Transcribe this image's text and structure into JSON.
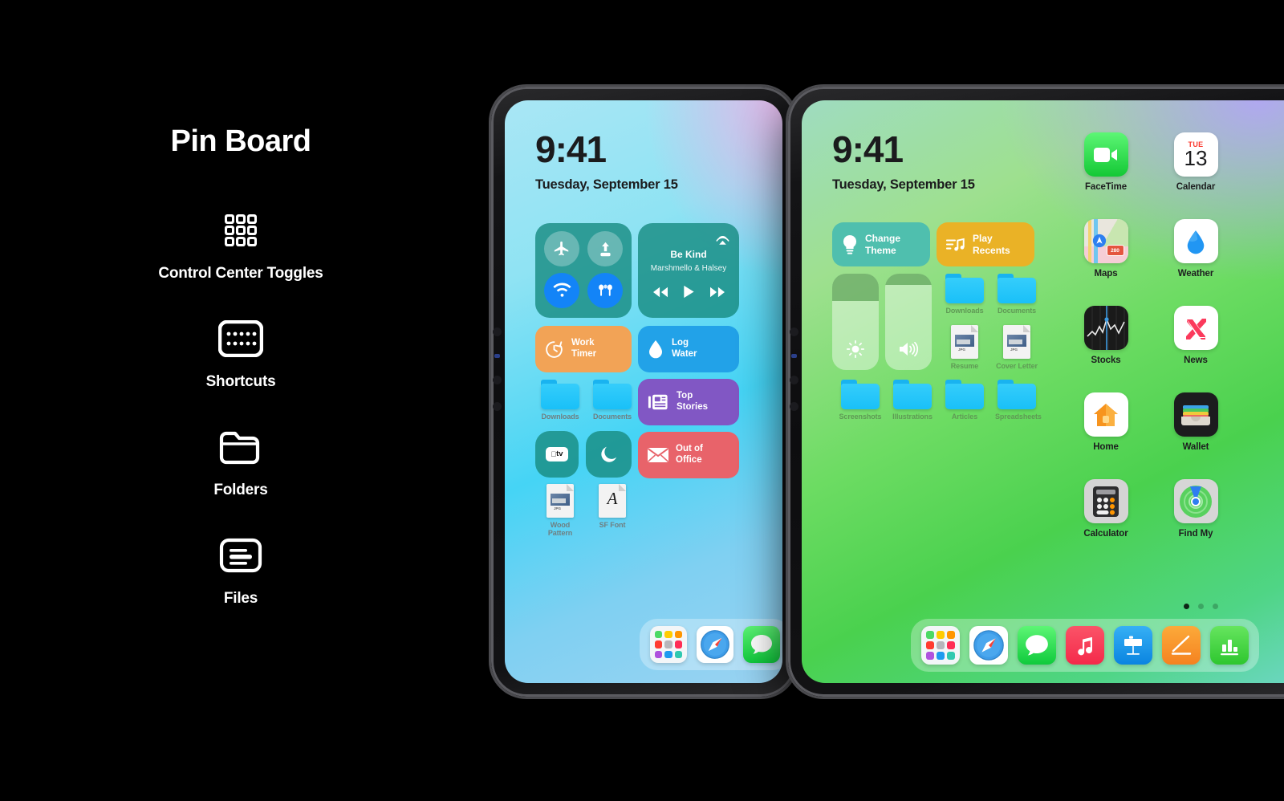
{
  "left_panel": {
    "title": "Pin Board",
    "features": [
      {
        "icon": "control-center-grid-icon",
        "label": "Control Center Toggles"
      },
      {
        "icon": "shortcuts-keyboard-icon",
        "label": "Shortcuts"
      },
      {
        "icon": "folder-icon",
        "label": "Folders"
      },
      {
        "icon": "files-card-icon",
        "label": "Files"
      }
    ]
  },
  "ipad_left": {
    "device": "iPad",
    "status": {
      "time": "9:41",
      "date": "Tuesday, September 15"
    },
    "toggles_tile": {
      "name": "control-center-toggles",
      "buttons": [
        {
          "icon": "airplane-icon",
          "state": "off"
        },
        {
          "icon": "airdrop-icon",
          "state": "off"
        },
        {
          "icon": "wifi-icon",
          "state": "on"
        },
        {
          "icon": "airpods-icon",
          "state": "on"
        }
      ]
    },
    "now_playing": {
      "track": "Be Kind",
      "artist": "Marshmello & Halsey",
      "airplay_icon": "airplay-icon",
      "controls": [
        "rewind-icon",
        "play-icon",
        "fast-forward-icon"
      ]
    },
    "shortcuts": [
      {
        "label": "Work\nTimer",
        "label_l1": "Work",
        "label_l2": "Timer",
        "icon": "timer-icon",
        "color": "#f2a356"
      },
      {
        "label": "Log Water",
        "label_l1": "Log",
        "label_l2": "Water",
        "icon": "droplet-icon",
        "color": "#22a2e8"
      },
      {
        "label": "Top Stories",
        "label_l1": "Top",
        "label_l2": "Stories",
        "icon": "news-icon",
        "color": "#8157c4"
      },
      {
        "label": "Out of Office",
        "label_l1": "Out of",
        "label_l2": "Office",
        "icon": "envelope-icon",
        "color": "#e8636a"
      }
    ],
    "folders": [
      {
        "label": "Downloads",
        "icon": "folder-icon"
      },
      {
        "label": "Documents",
        "icon": "folder-icon"
      }
    ],
    "app_tiles": [
      {
        "label": "Apple TV",
        "icon": "appletv-icon"
      },
      {
        "label": "Do Not Disturb",
        "icon": "moon-icon"
      }
    ],
    "files": [
      {
        "label": "Wood Pattern",
        "icon": "jpg-file-icon",
        "kind": "JPG"
      },
      {
        "label": "SF Font",
        "icon": "font-file-icon",
        "kind": "A"
      }
    ],
    "dock": [
      {
        "label": "App Library",
        "icon": "app-library-icon"
      },
      {
        "label": "Safari",
        "icon": "safari-icon"
      },
      {
        "label": "Messages",
        "icon": "messages-icon"
      }
    ]
  },
  "ipad_right": {
    "device": "iPad",
    "status": {
      "time": "9:41",
      "date": "Tuesday, September 15"
    },
    "shortcuts": [
      {
        "label_l1": "Change",
        "label_l2": "Theme",
        "icon": "lightbulb-icon",
        "color": "#4fbfae"
      },
      {
        "label_l1": "Play",
        "label_l2": "Recents",
        "icon": "playlist-icon",
        "color": "#eab226"
      }
    ],
    "sliders": [
      {
        "name": "brightness-slider",
        "icon": "brightness-icon",
        "value": 72
      },
      {
        "name": "volume-slider",
        "icon": "volume-icon",
        "value": 88
      }
    ],
    "folders_row1": [
      {
        "label": "Downloads",
        "icon": "folder-icon"
      },
      {
        "label": "Documents",
        "icon": "folder-icon"
      }
    ],
    "files_row": [
      {
        "label": "Resume",
        "icon": "jpg-file-icon",
        "kind": "JPG"
      },
      {
        "label": "Cover Letter",
        "icon": "jpg-file-icon",
        "kind": "JPG"
      }
    ],
    "folders_row2": [
      {
        "label": "Screenshots",
        "icon": "folder-icon"
      },
      {
        "label": "Illustrations",
        "icon": "folder-icon"
      },
      {
        "label": "Articles",
        "icon": "folder-icon"
      },
      {
        "label": "Spreadsheets",
        "icon": "folder-icon"
      }
    ],
    "apps": [
      {
        "label": "FaceTime",
        "icon": "facetime-icon"
      },
      {
        "label": "Calendar",
        "icon": "calendar-icon",
        "weekday": "TUE",
        "day": "13"
      },
      {
        "label": "Maps",
        "icon": "maps-icon",
        "route": "280"
      },
      {
        "label": "Weather",
        "icon": "weather-icon"
      },
      {
        "label": "Stocks",
        "icon": "stocks-icon"
      },
      {
        "label": "News",
        "icon": "news-app-icon"
      },
      {
        "label": "Home",
        "icon": "home-icon"
      },
      {
        "label": "Wallet",
        "icon": "wallet-icon"
      },
      {
        "label": "Calculator",
        "icon": "calculator-icon"
      },
      {
        "label": "Find My",
        "icon": "findmy-icon"
      }
    ],
    "page_dots": {
      "count": 3,
      "active": 1
    },
    "dock": [
      {
        "label": "App Library",
        "icon": "app-library-icon"
      },
      {
        "label": "Safari",
        "icon": "safari-icon"
      },
      {
        "label": "Messages",
        "icon": "messages-icon"
      },
      {
        "label": "Music",
        "icon": "music-icon"
      },
      {
        "label": "Keynote",
        "icon": "keynote-icon"
      },
      {
        "label": "Pages",
        "icon": "pages-icon"
      },
      {
        "label": "Numbers",
        "icon": "numbers-icon"
      }
    ]
  },
  "colors": {
    "background": "#000000",
    "text_primary": "#ffffff",
    "tile_teal": "#3cb9ad",
    "tile_orange": "#f2a356",
    "tile_blue": "#22a2e8",
    "tile_purple": "#8157c4",
    "tile_red": "#e8636a",
    "tile_yellow": "#eab226",
    "folder_blue": "#19c0f8"
  }
}
